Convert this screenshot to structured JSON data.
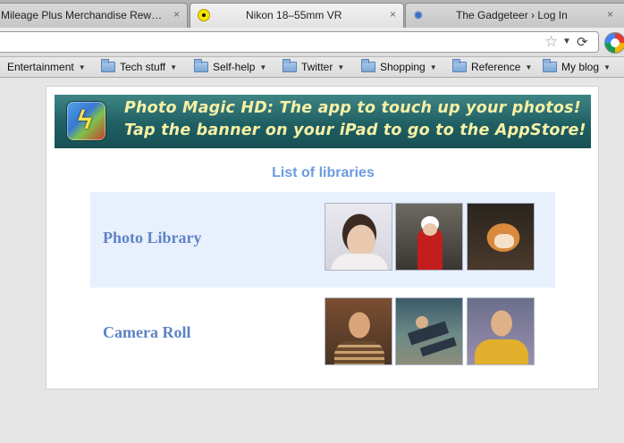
{
  "tabs": [
    {
      "title": "Mileage Plus Merchandise Rew…",
      "close": "×",
      "favicon": ""
    },
    {
      "title": "Nikon 18–55mm VR",
      "close": "×",
      "favicon": "yellow-dot-icon"
    },
    {
      "title": "The Gadgeteer › Log In",
      "close": "×",
      "favicon": "gear-icon"
    }
  ],
  "toolbar": {
    "star": "☆",
    "dropdown": "▼",
    "reload": "⟳"
  },
  "bookmarks": [
    {
      "label": "Entertainment",
      "folder": false
    },
    {
      "label": "Tech stuff",
      "folder": true
    },
    {
      "label": "Self-help",
      "folder": true
    },
    {
      "label": "Twitter",
      "folder": true
    },
    {
      "label": "Shopping",
      "folder": true
    },
    {
      "label": "Reference",
      "folder": true
    },
    {
      "label": "My blog",
      "folder": true
    }
  ],
  "bookmark_arrow": "▼",
  "banner": {
    "line1": "Photo Magic HD: The app to touch up your photos!",
    "line2": "Tap the banner on your iPad to go to the AppStore!",
    "icon_glyph": "ϟ"
  },
  "libraries": {
    "title": "List of libraries",
    "items": [
      {
        "label": "Photo Library"
      },
      {
        "label": "Camera Roll"
      }
    ]
  },
  "colors": {
    "accent_blue": "#6b9be0",
    "library_label": "#5d83c6",
    "row_highlight": "#e9f0fd",
    "banner_text": "#f5f0a6"
  }
}
